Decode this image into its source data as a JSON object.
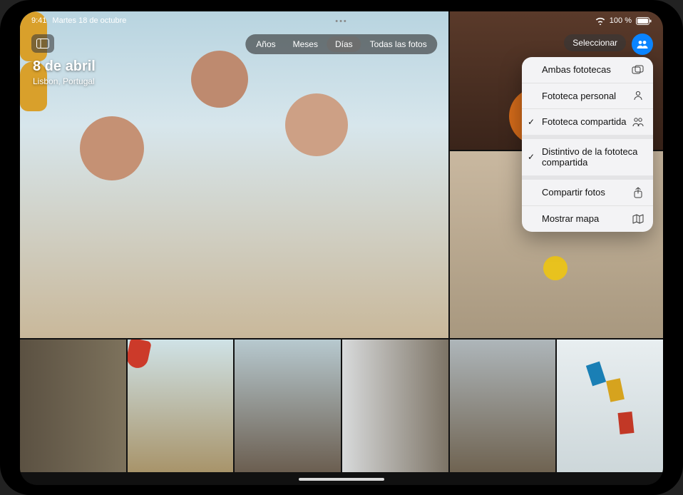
{
  "status": {
    "time": "9:41",
    "date": "Martes 18 de octubre",
    "battery_text": "100 %"
  },
  "header": {
    "date_title": "8 de abril",
    "location": "Lisbon, Portugal",
    "select_label": "Seleccionar"
  },
  "segmented": {
    "items": [
      {
        "label": "Años"
      },
      {
        "label": "Meses"
      },
      {
        "label": "Días"
      },
      {
        "label": "Todas las fotos"
      }
    ],
    "active_index": 2
  },
  "menu": {
    "items": [
      {
        "label": "Ambas fototecas",
        "icon": "both-libraries",
        "checked": false
      },
      {
        "label": "Fototeca personal",
        "icon": "person",
        "checked": false
      },
      {
        "label": "Fototeca compartida",
        "icon": "people",
        "checked": true
      }
    ],
    "badge": {
      "label": "Distintivo de la fototeca compartida",
      "checked": true
    },
    "actions": [
      {
        "label": "Compartir fotos",
        "icon": "share"
      },
      {
        "label": "Mostrar mapa",
        "icon": "map"
      }
    ]
  }
}
